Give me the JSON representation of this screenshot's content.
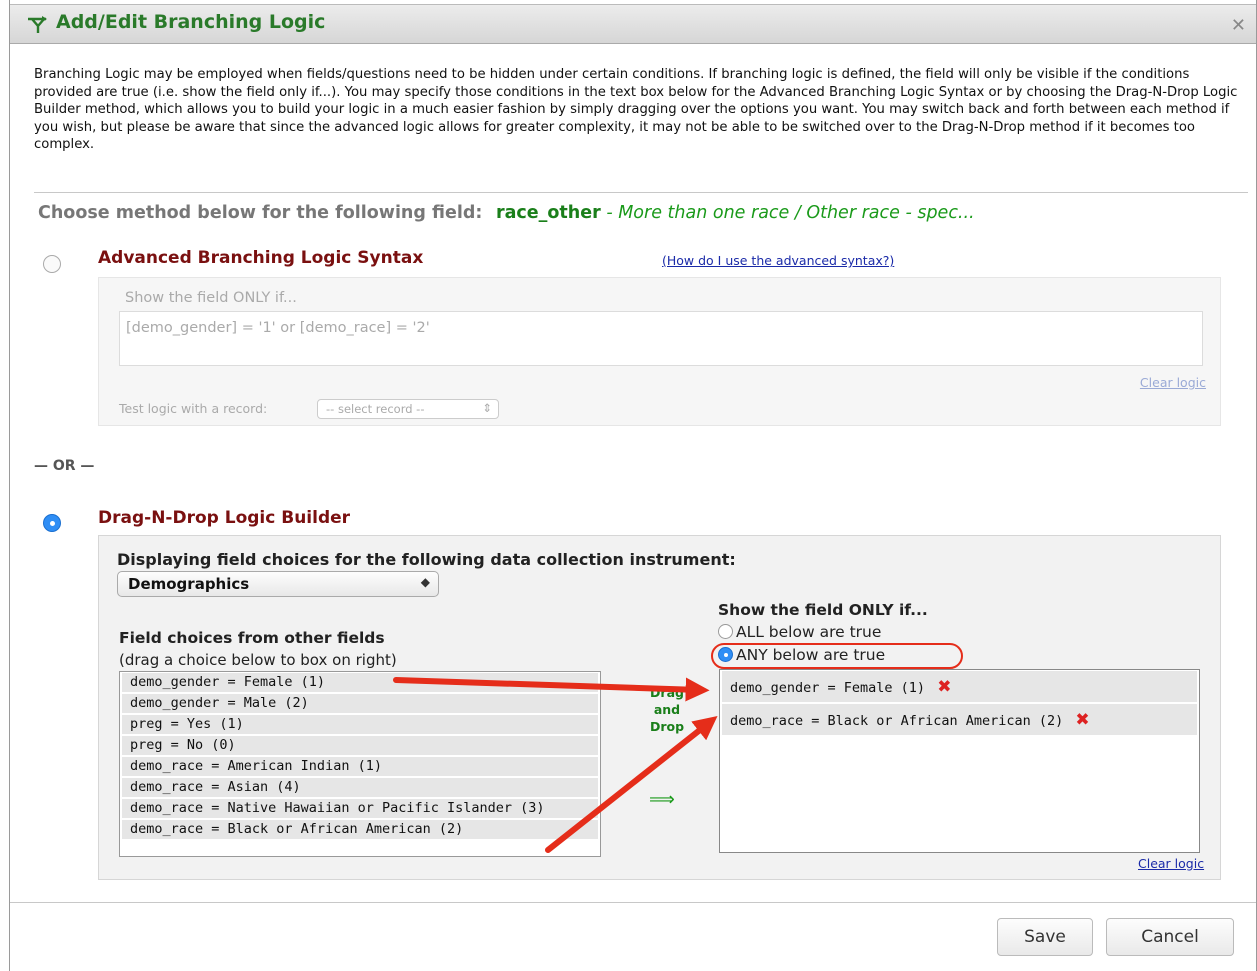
{
  "dialog": {
    "title": "Add/Edit Branching Logic",
    "close_label": "✕",
    "intro": "Branching Logic may be employed when fields/questions need to be hidden under certain conditions. If branching logic is defined, the field will only be visible if the conditions provided are true (i.e. show the field only if...). You may specify those conditions in the text box below for the Advanced Branching Logic Syntax or by choosing the Drag-N-Drop Logic Builder method, which allows you to build your logic in a much easier fashion by simply dragging over the options you want. You may switch back and forth between each method if you wish, but please be aware that since the advanced logic allows for greater complexity, it may not be able to be switched over to the Drag-N-Drop method if it becomes too complex."
  },
  "choose": {
    "label": "Choose method below for the following field:",
    "field_name": "race_other",
    "field_desc": "- More than one race / Other race - spec..."
  },
  "advanced": {
    "title": "Advanced Branching Logic Syntax",
    "help_link": "(How do I use the advanced syntax?)",
    "show_label": "Show the field ONLY if...",
    "logic_text": "[demo_gender] = '1' or [demo_race] = '2'",
    "clear_link": "Clear logic",
    "test_label": "Test logic with a record:",
    "test_select": "-- select record --",
    "selected": false
  },
  "or_label": "— OR —",
  "dnd": {
    "title": "Drag-N-Drop Logic Builder",
    "selected": true,
    "display_label": "Displaying field choices for the following data collection instrument:",
    "instrument": "Demographics",
    "field_choices_title": "Field choices from other fields",
    "field_choices_sub": "(drag a choice below to box on right)",
    "choices": [
      "demo_gender = Female (1)",
      "demo_gender = Male (2)",
      "preg = Yes (1)",
      "preg = No (0)",
      "demo_race = American Indian (1)",
      "demo_race = Asian (4)",
      "demo_race = Native Hawaiian or Pacific Islander (3)",
      "demo_race = Black or African American (2)"
    ],
    "drag_label_1": "Drag",
    "drag_label_2": "and",
    "drag_label_3": "Drop",
    "drag_arrow": "⟹",
    "show_label": "Show the field ONLY if...",
    "option_all": "ALL below are true",
    "option_any": "ANY below are true",
    "selected_option": "any",
    "dropped": [
      "demo_gender = Female (1)",
      "demo_race = Black or African American (2)"
    ],
    "remove_icon": "✖",
    "clear_link": "Clear logic"
  },
  "buttons": {
    "save": "Save",
    "cancel": "Cancel"
  },
  "colors": {
    "annotation": "#e52d1a",
    "title_green": "#2a7a2a",
    "section_red": "#7a1010",
    "radio_blue": "#2f8ef5"
  }
}
